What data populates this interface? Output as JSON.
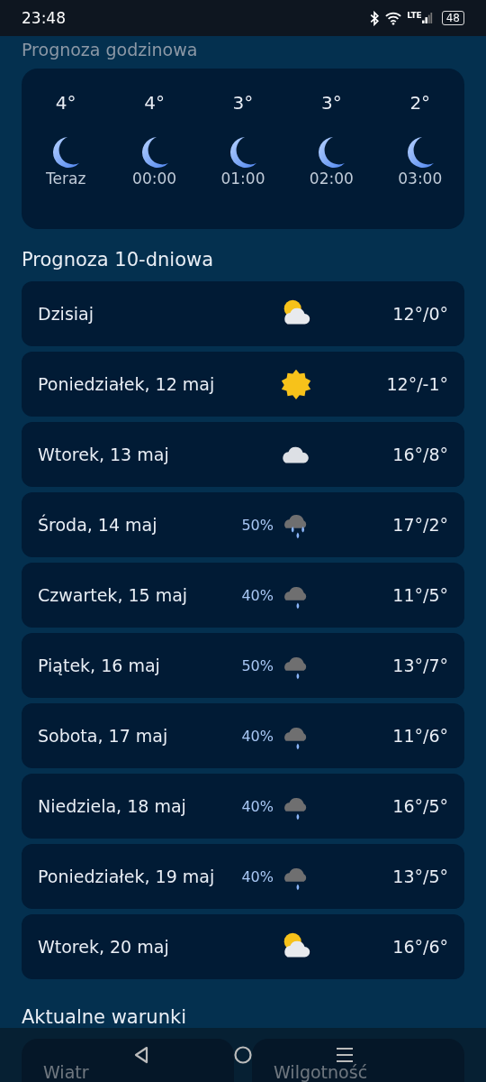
{
  "status_bar": {
    "time": "23:48",
    "network": "LTE",
    "battery": "48"
  },
  "hourly": {
    "title": "Prognoza godzinowa",
    "items": [
      {
        "temp": "4°",
        "kind": "moon",
        "time": "Teraz"
      },
      {
        "temp": "4°",
        "kind": "moon",
        "time": "00:00"
      },
      {
        "temp": "3°",
        "kind": "moon",
        "time": "01:00"
      },
      {
        "temp": "3°",
        "kind": "moon",
        "time": "02:00"
      },
      {
        "temp": "2°",
        "kind": "moon",
        "time": "03:00"
      }
    ]
  },
  "daily": {
    "title": "Prognoza 10-dniowa",
    "days": [
      {
        "day": "Dzisiaj",
        "kind": "partly_cloudy",
        "temps": "12°/0°"
      },
      {
        "day": "Poniedziałek, 12 maj",
        "kind": "sunny",
        "temps": "12°/-1°"
      },
      {
        "day": "Wtorek, 13 maj",
        "kind": "cloudy",
        "temps": "16°/8°"
      },
      {
        "day": "Środa, 14 maj",
        "precip": "50%",
        "kind": "heavy_rain",
        "temps": "17°/2°"
      },
      {
        "day": "Czwartek, 15 maj",
        "precip": "40%",
        "kind": "rain",
        "temps": "11°/5°"
      },
      {
        "day": "Piątek, 16 maj",
        "precip": "50%",
        "kind": "rain",
        "temps": "13°/7°"
      },
      {
        "day": "Sobota, 17 maj",
        "precip": "40%",
        "kind": "rain",
        "temps": "11°/6°"
      },
      {
        "day": "Niedziela, 18 maj",
        "precip": "40%",
        "kind": "rain",
        "temps": "16°/5°"
      },
      {
        "day": "Poniedziałek, 19 maj",
        "precip": "40%",
        "kind": "rain",
        "temps": "13°/5°"
      },
      {
        "day": "Wtorek, 20 maj",
        "kind": "partly_cloudy",
        "temps": "16°/6°"
      }
    ]
  },
  "conditions": {
    "title": "Aktualne warunki",
    "cards": [
      "Wiatr",
      "Wilgotność"
    ]
  }
}
